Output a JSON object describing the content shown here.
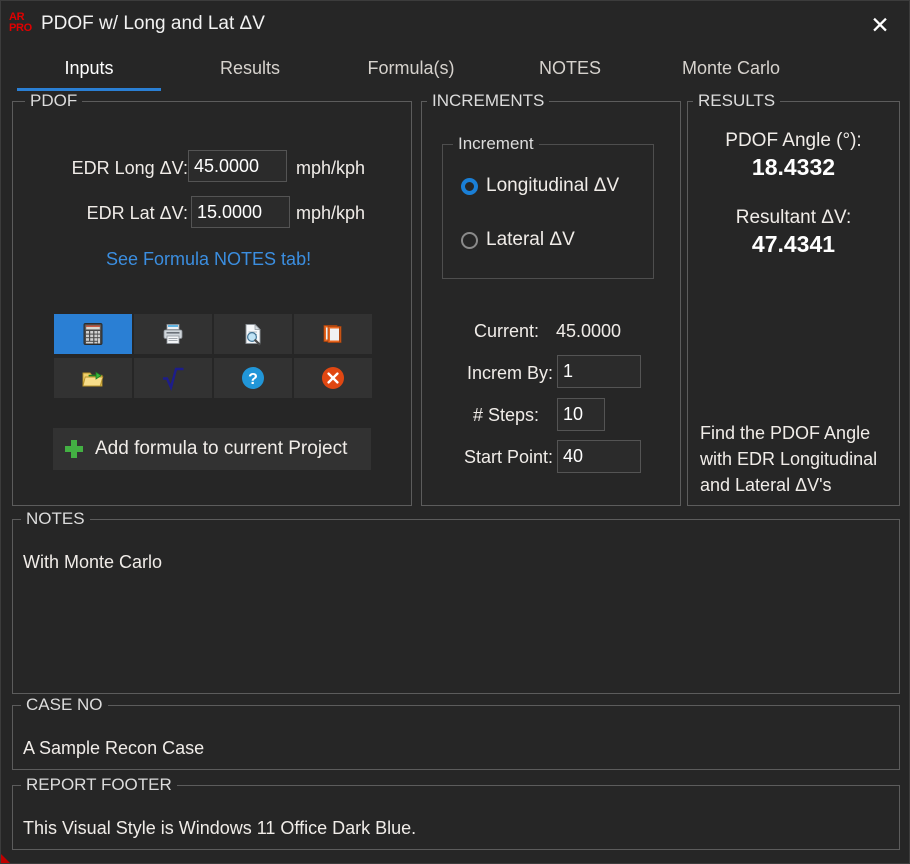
{
  "window": {
    "title": "PDOF w/ Long and Lat ΔV",
    "app_icon_line1": "AR",
    "app_icon_line2": "PRO",
    "close_label": "✕",
    "accent_color": "#2a7fd4",
    "background_color": "#262626"
  },
  "tabs": [
    {
      "label": "Inputs",
      "active": true
    },
    {
      "label": "Results",
      "active": false
    },
    {
      "label": "Formula(s)",
      "active": false
    },
    {
      "label": "NOTES",
      "active": false
    },
    {
      "label": "Monte Carlo",
      "active": false
    }
  ],
  "pdof": {
    "legend": "PDOF",
    "long_label": "EDR Long ΔV:",
    "long_value": "45.0000",
    "long_unit": "mph/kph",
    "lat_label": "EDR Lat ΔV:",
    "lat_value": "15.0000",
    "lat_unit": "mph/kph",
    "note_link": "See Formula NOTES tab!",
    "toolbar": [
      {
        "name": "calculate-button",
        "icon": "calculator-icon",
        "selected": true
      },
      {
        "name": "print-button",
        "icon": "printer-icon",
        "selected": false
      },
      {
        "name": "print-preview-button",
        "icon": "document-search-icon",
        "selected": false
      },
      {
        "name": "notes-book-button",
        "icon": "book-icon",
        "selected": false
      },
      {
        "name": "open-button",
        "icon": "open-folder-icon",
        "selected": false
      },
      {
        "name": "square-root-button",
        "icon": "radical-icon",
        "selected": false
      },
      {
        "name": "help-button",
        "icon": "question-help-icon",
        "selected": false
      },
      {
        "name": "close-formula-button",
        "icon": "close-circle-icon",
        "selected": false
      }
    ],
    "add_button_label": "Add formula to current Project"
  },
  "increments": {
    "legend": "INCREMENTS",
    "sub_legend": "Increment",
    "options": [
      {
        "label": "Longitudinal ΔV",
        "selected": true
      },
      {
        "label": "Lateral ΔV",
        "selected": false
      }
    ],
    "current_label": "Current:",
    "current_value": "45.0000",
    "increm_by_label": "Increm By:",
    "increm_by_value": "1",
    "steps_label": "# Steps:",
    "steps_value": "10",
    "start_point_label": "Start Point:",
    "start_point_value": "40"
  },
  "results": {
    "legend": "RESULTS",
    "angle_label": "PDOF Angle (°):",
    "angle_value": "18.4332",
    "resultant_label": "Resultant ΔV:",
    "resultant_value": "47.4341",
    "description": "Find the PDOF Angle with EDR Longitudinal and Lateral ΔV's"
  },
  "notes": {
    "legend": "NOTES",
    "value": "With Monte Carlo"
  },
  "case_no": {
    "legend": "CASE NO",
    "value": "A Sample Recon Case"
  },
  "report_footer": {
    "legend": "REPORT FOOTER",
    "value": "This Visual Style is Windows 11 Office Dark Blue."
  }
}
